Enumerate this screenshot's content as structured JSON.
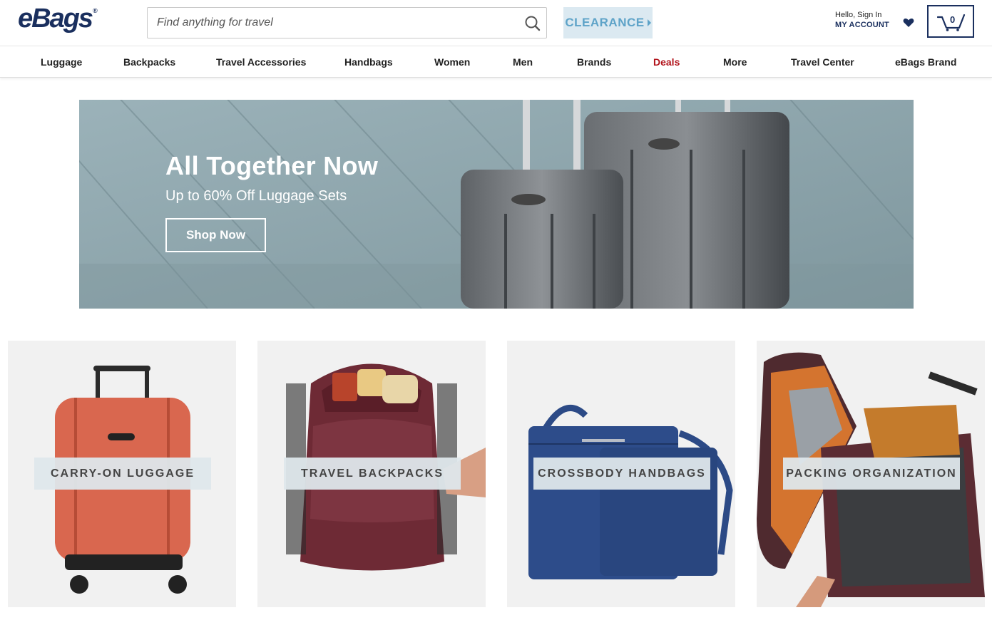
{
  "header": {
    "logo_text": "eBags",
    "logo_reg": "®",
    "search_placeholder": "Find anything for travel",
    "search_value": "",
    "search_icon": "search-icon",
    "clearance_label": "CLEARANCE",
    "account_greeting": "Hello, Sign In",
    "account_label": "MY ACCOUNT",
    "wishlist_icon": "heart-icon",
    "cart_icon": "cart-icon",
    "cart_count": "0"
  },
  "nav": {
    "items": [
      {
        "label": "Luggage"
      },
      {
        "label": "Backpacks"
      },
      {
        "label": "Travel Accessories"
      },
      {
        "label": "Handbags"
      },
      {
        "label": "Women"
      },
      {
        "label": "Men"
      },
      {
        "label": "Brands"
      },
      {
        "label": "Deals",
        "highlight": true
      },
      {
        "label": "More"
      },
      {
        "label": "Travel Center"
      }
    ],
    "brand_item": {
      "bold": "eBags",
      "rest": " Brand"
    }
  },
  "hero": {
    "title": "All Together Now",
    "subtitle": "Up to 60% Off Luggage Sets",
    "cta": "Shop Now"
  },
  "categories": [
    {
      "label": "CARRY-ON LUGGAGE"
    },
    {
      "label": "TRAVEL BACKPACKS"
    },
    {
      "label": "CROSSBODY HANDBAGS"
    },
    {
      "label": "PACKING ORGANIZATION"
    }
  ],
  "colors": {
    "brand_navy": "#1a2f5e",
    "clearance_bg": "#dbe9f1",
    "clearance_text": "#5ea3c8",
    "deals_red": "#b2141c"
  }
}
